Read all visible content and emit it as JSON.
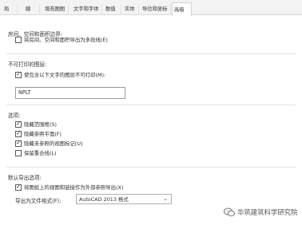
{
  "tabs": [
    "局",
    "線",
    "填充图图",
    "文字和字体",
    "数值",
    "实体",
    "导位和坐标",
    "高级"
  ],
  "sections": {
    "room": {
      "title": "房间、空间和面积边界:",
      "checkbox": {
        "label": "将房间、空间和面积导出为多段线(E)",
        "checked": false
      }
    },
    "nonplot": {
      "title": "不可打印的图层:",
      "checkbox": {
        "label": "使包含以下文字的图层不可打印(M):",
        "checked": true
      },
      "textbox_value": "NPLT"
    },
    "options": {
      "title": "选项:",
      "items": [
        {
          "label": "隐藏范围框(S)",
          "checked": true
        },
        {
          "label": "隐藏参照平面(F)",
          "checked": true
        },
        {
          "label": "隐藏未参照的视图标记(U)",
          "checked": true
        },
        {
          "label": "保留重合线(L)",
          "checked": false
        }
      ]
    },
    "default_export": {
      "title": "默认导出选项:",
      "checkbox": {
        "label": "将图纸上的视图和链接作为外部参照导出(X)",
        "checked": true
      },
      "format_label": "导出为文件格式(F):",
      "format_value": "AutoCAD 2013 格式"
    }
  },
  "watermark": "华筑建筑科学研究院"
}
